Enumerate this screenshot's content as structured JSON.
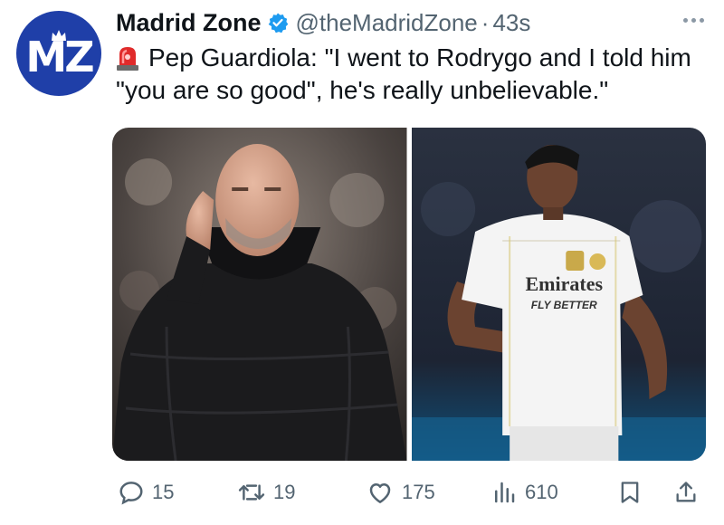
{
  "author": {
    "name": "Madrid Zone",
    "handle": "@theMadridZone",
    "separator": "·",
    "time": "43s",
    "avatar_text": "MZ",
    "verified_color": "#1d9bf0",
    "avatar_color": "#1f3fa8"
  },
  "tweet": {
    "emoji": "siren-icon",
    "text": "Pep Guardiola: \"I went to Rodrygo and I told him \"you are so good\", he's really unbelievable.\""
  },
  "media": {
    "photos": [
      "guardiola-photo",
      "rodrygo-photo"
    ],
    "jersey_sponsor": "Emirates",
    "jersey_slogan": "FLY BETTER"
  },
  "actions": {
    "replies": "15",
    "reposts": "19",
    "likes": "175",
    "views": "610"
  },
  "icons": [
    "siren-icon",
    "verified-icon",
    "more-icon",
    "reply-icon",
    "repost-icon",
    "like-icon",
    "views-icon",
    "bookmark-icon",
    "share-icon"
  ]
}
